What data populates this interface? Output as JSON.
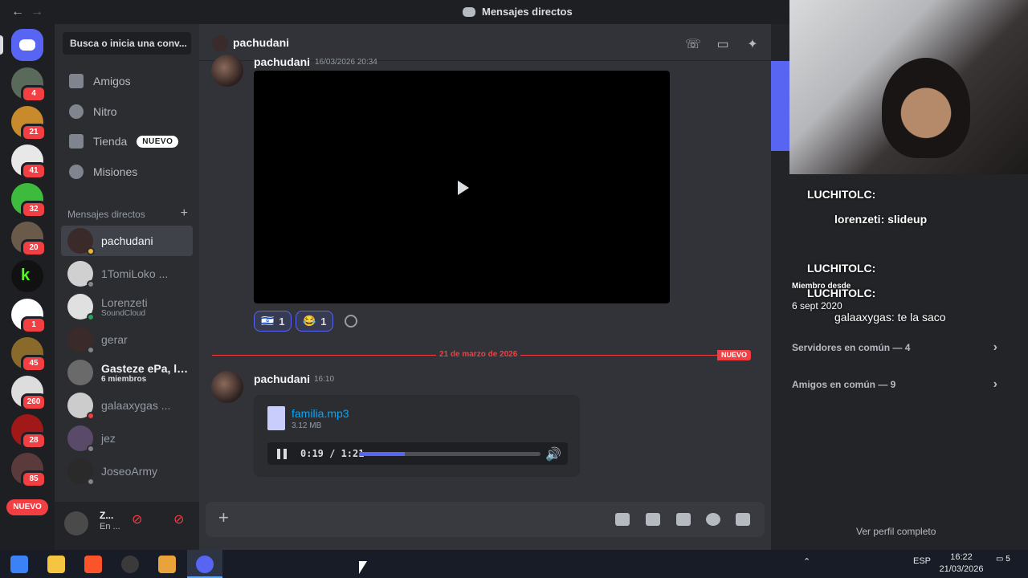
{
  "window": {
    "title": "Mensajes directos",
    "back_icon": "arrow-left-icon",
    "forward_icon": "arrow-right-icon"
  },
  "servers": {
    "badges": [
      "4",
      "21",
      "41",
      "32",
      "20",
      "1",
      "45",
      "260",
      "28",
      "85"
    ],
    "new_pill": "NUEVO"
  },
  "sidebar": {
    "search_placeholder": "Busca o inicia una conv...",
    "nav": [
      {
        "label": "Amigos",
        "icon": "friends-icon"
      },
      {
        "label": "Nitro",
        "icon": "nitro-icon"
      },
      {
        "label": "Tienda",
        "icon": "shop-icon",
        "tag": "NUEVO"
      },
      {
        "label": "Misiones",
        "icon": "quests-icon"
      }
    ],
    "dm_header": "Mensajes directos",
    "dm_add": "+",
    "dms": [
      {
        "name": "pachudani",
        "sub": ""
      },
      {
        "name": "1TomiLoko ...",
        "sub": ""
      },
      {
        "name": "Lorenzeti",
        "sub": "SoundCloud"
      },
      {
        "name": "gerar",
        "sub": ""
      },
      {
        "name": "Gasteze ePa, le...",
        "sub": "6 miembros"
      },
      {
        "name": "galaaxygas ...",
        "sub": ""
      },
      {
        "name": "jez",
        "sub": ""
      },
      {
        "name": "JoseoArmy",
        "sub": ""
      }
    ]
  },
  "userbar": {
    "name": "Z...",
    "status": "En ..."
  },
  "chat": {
    "header_name": "pachudani",
    "top_message": {
      "user": "pachudani",
      "time": "16/03/2026 20:34"
    },
    "reactions": [
      {
        "emoji": "🇮🇱",
        "count": "1"
      },
      {
        "emoji": "😂",
        "count": "1"
      }
    ],
    "divider_date": "21 de marzo de 2026",
    "divider_new": "NUEVO",
    "message": {
      "user": "pachudani",
      "time": "16:10"
    },
    "attachment": {
      "file_name": "familia.mp3",
      "file_size": "3.12 MB",
      "time_display": "0:19 / 1:21",
      "progress": 0.25
    },
    "composer_plus": "+"
  },
  "profile": {
    "overlay_lines": [
      "LUCHITOLC:",
      "lorenzeti: slideup",
      "LUCHITOLC:",
      "LUCHITOLC:",
      "galaaxygas: te la saco"
    ],
    "member_since_label": "Miembro desde",
    "member_since": "6 sept 2020",
    "mutual_servers": "Servidores en común — 4",
    "mutual_friends": "Amigos en común — 9",
    "view_full": "Ver perfil completo"
  },
  "taskbar": {
    "language": "ESP",
    "time": "16:22",
    "date": "21/03/2026",
    "notifications": "5"
  },
  "colors": {
    "accent": "#5865f2",
    "danger": "#f23f43",
    "link": "#00a8fc"
  }
}
